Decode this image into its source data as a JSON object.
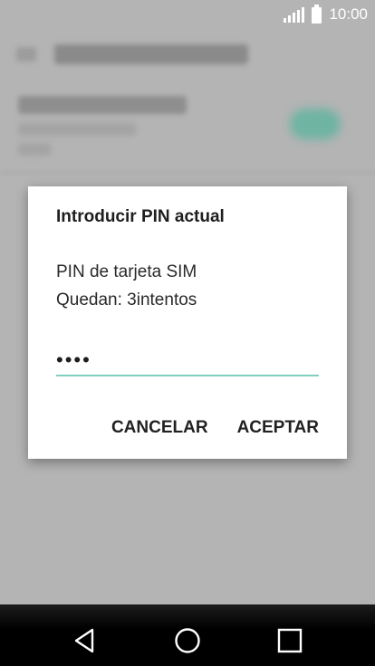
{
  "status_bar": {
    "time": "10:00",
    "icons": [
      "signal-icon",
      "battery-icon"
    ]
  },
  "dialog": {
    "title": "Introducir PIN actual",
    "line_1": "PIN de tarjeta SIM",
    "line_2": "Quedan: 3intentos",
    "pin_value": "••••",
    "cancel_label": "CANCELAR",
    "accept_label": "ACEPTAR"
  },
  "nav_bar": {
    "icons": [
      "back-icon",
      "home-icon",
      "recents-icon"
    ]
  },
  "colors": {
    "scrim_background": "#b4b4b4",
    "input_underline": "#7fcfc0",
    "toggle_accent": "#6fb4a3",
    "nav_background": "#000000"
  }
}
